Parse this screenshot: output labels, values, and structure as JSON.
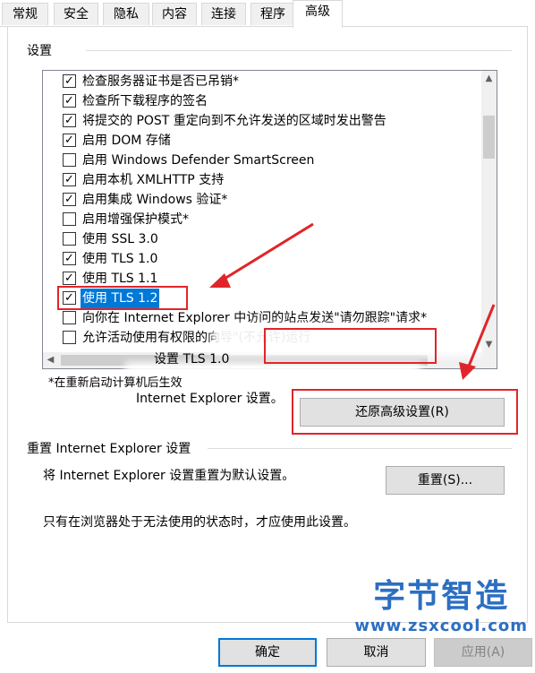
{
  "tabs": [
    {
      "label": "常规",
      "active": false
    },
    {
      "label": "安全",
      "active": false
    },
    {
      "label": "隐私",
      "active": false
    },
    {
      "label": "内容",
      "active": false
    },
    {
      "label": "连接",
      "active": false
    },
    {
      "label": "程序",
      "active": false
    },
    {
      "label": "高级",
      "active": true
    }
  ],
  "settings": {
    "title": "设置",
    "items": [
      {
        "label": "检查服务器证书是否已吊销*",
        "checked": true
      },
      {
        "label": "检查所下载程序的签名",
        "checked": true
      },
      {
        "label": "将提交的 POST 重定向到不允许发送的区域时发出警告",
        "checked": true
      },
      {
        "label": "启用 DOM 存储",
        "checked": true
      },
      {
        "label": "启用 Windows Defender SmartScreen",
        "checked": false
      },
      {
        "label": "启用本机 XMLHTTP 支持",
        "checked": true
      },
      {
        "label": "启用集成 Windows 验证*",
        "checked": true
      },
      {
        "label": "启用增强保护模式*",
        "checked": false
      },
      {
        "label": "使用 SSL 3.0",
        "checked": false
      },
      {
        "label": "使用 TLS 1.0",
        "checked": true
      },
      {
        "label": "使用 TLS 1.1",
        "checked": true
      },
      {
        "label": "使用 TLS 1.2",
        "checked": true,
        "selected": true
      },
      {
        "label": "向你在 Internet Explorer 中访问的站点发送\"请勿跟踪\"请求*",
        "checked": false
      },
      {
        "label": "允许活动使用有权限的向导\"(不允许)运行",
        "checked": false
      }
    ],
    "overlay_text": "设置 TLS 1.0",
    "restart_note": "*在重新启动计算机后生效",
    "restore_note": "Internet Explorer 设置。",
    "restore_button": "还原高级设置(R)"
  },
  "reset": {
    "title": "重置 Internet Explorer 设置",
    "description": "将 Internet Explorer 设置重置为默认设置。",
    "button": "重置(S)...",
    "note": "只有在浏览器处于无法使用的状态时，才应使用此设置。"
  },
  "footer": {
    "ok": "确定",
    "cancel": "取消",
    "apply": "应用(A)"
  },
  "watermark": {
    "name": "字节智造",
    "url": "www.zsxcool.com"
  },
  "colors": {
    "accent": "#0078d7",
    "annotation_red": "#e0252a",
    "watermark_blue": "#2c6fc2"
  }
}
